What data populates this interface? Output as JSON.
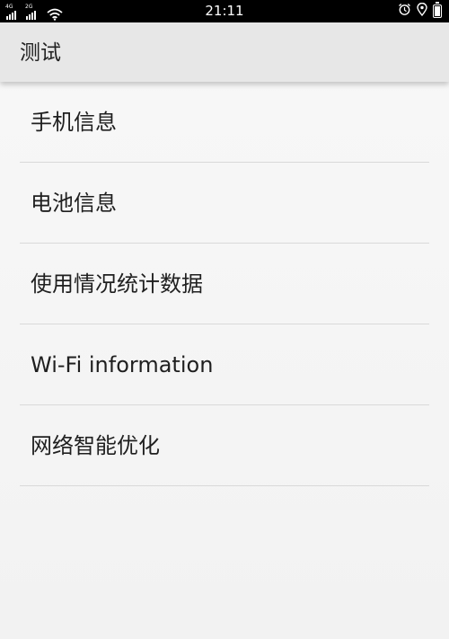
{
  "status_bar": {
    "sim1_label": "4G",
    "sim2_label": "2G",
    "time": "21:11",
    "icons": [
      "signal-icon",
      "signal-icon",
      "wifi-icon",
      "alarm-icon",
      "location-icon",
      "battery-icon"
    ]
  },
  "app_bar": {
    "title": "测试"
  },
  "menu": {
    "items": [
      {
        "label": "手机信息"
      },
      {
        "label": "电池信息"
      },
      {
        "label": "使用情况统计数据"
      },
      {
        "label": "Wi-Fi information"
      },
      {
        "label": "网络智能优化"
      }
    ]
  },
  "colors": {
    "status_bar_bg": "#000000",
    "app_bar_bg": "#e7e7e7",
    "list_bg": "#f6f6f6",
    "divider": "#d9d9d9",
    "text": "#1f1f1f"
  }
}
